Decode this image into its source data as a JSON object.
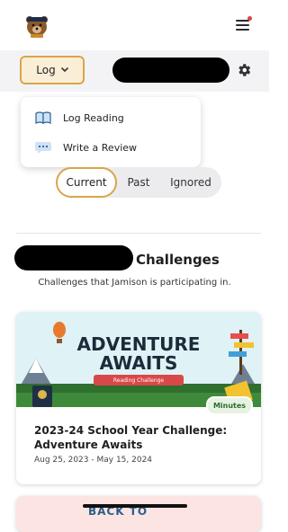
{
  "header": {
    "logo_icon": "bear-mascot-icon",
    "menu_icon": "hamburger-menu-icon",
    "notification_dot_color": "#e04040"
  },
  "toolbar": {
    "log_label": "Log",
    "log_chevron_icon": "chevron-down-icon",
    "settings_icon": "gear-icon",
    "accent_color": "#d9a54a"
  },
  "log_menu": {
    "items": [
      {
        "label": "Log Reading",
        "icon": "open-book-icon"
      },
      {
        "label": "Write a Review",
        "icon": "speech-bubble-icon"
      }
    ]
  },
  "tabs": {
    "items": [
      "Current",
      "Past",
      "Ignored"
    ],
    "active": "Current"
  },
  "challenges": {
    "heading": "Challenges",
    "subtitle": "Challenges that Jamison is participating in."
  },
  "cards": [
    {
      "banner_line1": "ADVENTURE",
      "banner_line2": "AWAITS",
      "ribbon": "Reading Challenge",
      "badge": "Minutes",
      "title": "2023-24 School Year Challenge: Adventure Awaits",
      "dates": "Aug 25, 2023 - May 15, 2024"
    },
    {
      "banner_partial": "BACK TO"
    }
  ]
}
